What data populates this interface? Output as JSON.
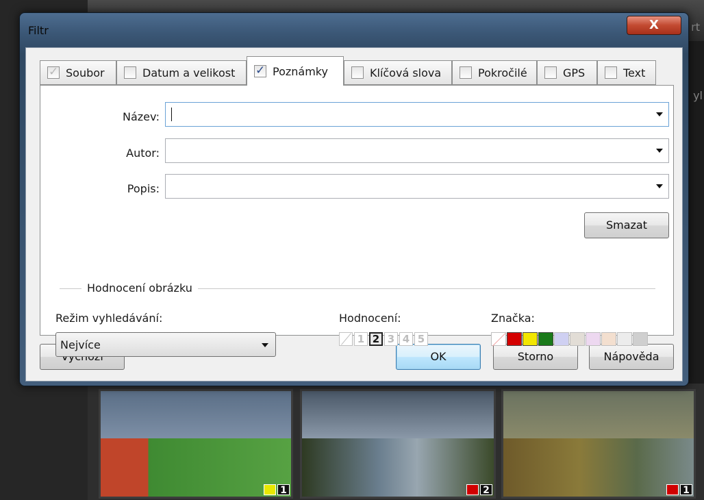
{
  "background": {
    "top_right_text": "rt",
    "side_text": "yl",
    "thumbnails": [
      {
        "color": "#e8e800",
        "rating": "1"
      },
      {
        "color": "#d00000",
        "rating": "2"
      },
      {
        "color": "#d00000",
        "rating": "1"
      }
    ]
  },
  "dialog": {
    "title": "Filtr",
    "close_label": "X"
  },
  "tabs": [
    {
      "label": "Soubor",
      "state": "disabled-checked"
    },
    {
      "label": "Datum a velikost",
      "state": "unchecked"
    },
    {
      "label": "Poznámky",
      "state": "checked-active"
    },
    {
      "label": "Klíčová slova",
      "state": "unchecked"
    },
    {
      "label": "Pokročilé",
      "state": "unchecked"
    },
    {
      "label": "GPS",
      "state": "unchecked"
    },
    {
      "label": "Text",
      "state": "unchecked"
    }
  ],
  "fields": {
    "name_label": "Název:",
    "name_value": "",
    "author_label": "Autor:",
    "author_value": "",
    "description_label": "Popis:",
    "description_value": ""
  },
  "clear_button": "Smazat",
  "rating_group": {
    "title": "Hodnocení obrázku",
    "mode_label": "Režim vyhledávání:",
    "mode_value": "Nejvíce",
    "rating_label": "Hodnocení:",
    "ratings": [
      "1",
      "2",
      "3",
      "4",
      "5"
    ],
    "selected_rating": "2",
    "mark_label": "Značka:",
    "mark_colors": [
      "#d40000",
      "#f2e600",
      "#1a7a1a",
      "#cfd0f2",
      "#e2ddd6",
      "#edd8f0",
      "#f3dfcf",
      "#ececec",
      "#cfcfcf"
    ]
  },
  "buttons": {
    "default": "Výchozí",
    "ok": "OK",
    "cancel": "Storno",
    "help": "Nápověda"
  }
}
